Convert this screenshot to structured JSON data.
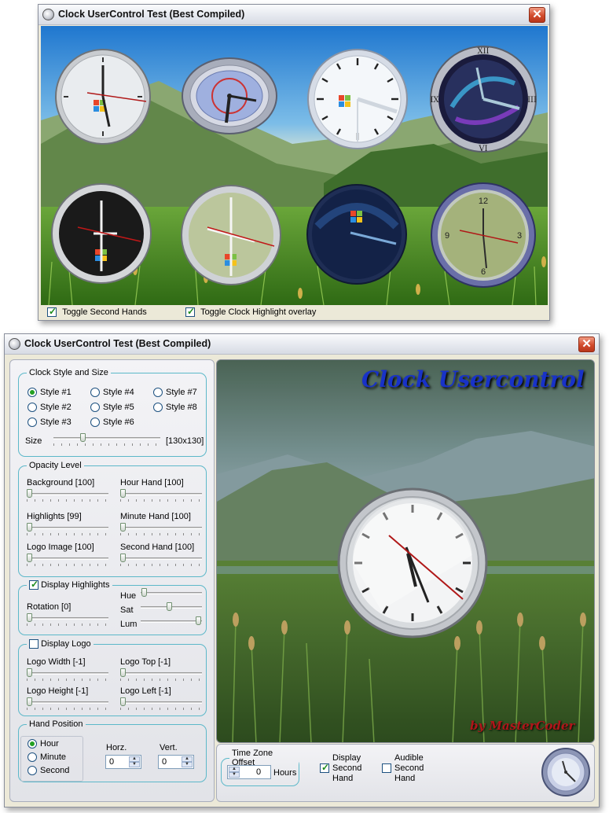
{
  "window_top": {
    "title": "Clock UserControl Test (Best Compiled)",
    "close": "✕",
    "toggles": [
      {
        "label": "Toggle Second Hands",
        "checked": true
      },
      {
        "label": "Toggle Clock Highlight overlay",
        "checked": true
      }
    ],
    "clock_faces": {
      "numerals_roman": [
        "XII",
        "III",
        "VI",
        "IX"
      ],
      "numerals_arabic": [
        "12",
        "3",
        "6",
        "9"
      ]
    }
  },
  "window_bottom": {
    "title": "Clock UserControl Test (Best Compiled)",
    "close": "✕",
    "style_group": {
      "legend": "Clock Style and Size",
      "styles": [
        "Style #1",
        "Style #2",
        "Style #3",
        "Style #4",
        "Style #5",
        "Style #6",
        "Style #7",
        "Style #8"
      ],
      "selected": "Style #1",
      "size_label": "Size",
      "size_value": "[130x130]",
      "size_slider": 0.26
    },
    "opacity_group": {
      "legend": "Opacity Level",
      "background": {
        "label": "Background [100]",
        "value": 0.0
      },
      "hour_hand": {
        "label": "Hour Hand [100]",
        "value": 0.0
      },
      "highlights": {
        "label": "Highlights [99]",
        "value": 0.0
      },
      "minute_hand": {
        "label": "Minute Hand [100]",
        "value": 0.0
      },
      "logo_image": {
        "label": "Logo Image [100]",
        "value": 0.0
      },
      "second_hand": {
        "label": "Second Hand [100]",
        "value": 0.0
      }
    },
    "highlights_group": {
      "legend": "Display Highlights",
      "checked": true,
      "rotation": {
        "label": "Rotation [0]",
        "value": 0.0
      },
      "hue_label": "Hue",
      "hue": 0.02,
      "sat_label": "Sat",
      "sat": 0.46,
      "lum_label": "Lum",
      "lum": 0.98
    },
    "logo_group": {
      "legend": "Display Logo",
      "checked": false,
      "width": {
        "label": "Logo Width [-1]",
        "value": 0.0
      },
      "top": {
        "label": "Logo Top [-1]",
        "value": 0.0
      },
      "height": {
        "label": "Logo Height [-1]",
        "value": 0.0
      },
      "left": {
        "label": "Logo Left [-1]",
        "value": 0.0
      }
    },
    "hand_group": {
      "legend": "Hand Position",
      "options": [
        "Hour",
        "Minute",
        "Second"
      ],
      "selected": "Hour",
      "horz_label": "Horz.",
      "horz_value": "0",
      "vert_label": "Vert.",
      "vert_value": "0"
    },
    "preview": {
      "title": "Clock Usercontrol",
      "credit": "by MasterCoder"
    },
    "tz_group": {
      "legend": "Time Zone Offset",
      "value": "0",
      "unit": "Hours"
    },
    "display_second": {
      "label": "Display Second Hand",
      "checked": true
    },
    "audible_second": {
      "label": "Audible Second Hand",
      "checked": false
    }
  },
  "colors": {
    "group_border": "#5cb8c9",
    "title_blue": "#1832c8",
    "credit_red": "#b0161a",
    "second_hand_red": "#c01818"
  }
}
